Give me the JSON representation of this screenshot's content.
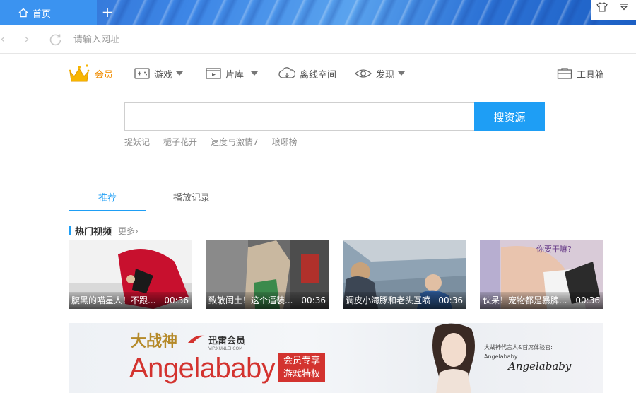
{
  "browser": {
    "tab": {
      "title": "首页",
      "icon": "home-icon"
    },
    "new_tab_icon": "plus-icon",
    "address": {
      "placeholder": "请输入网址",
      "value": ""
    }
  },
  "nav": {
    "vip": "会员",
    "games": "游戏",
    "library": "片库",
    "offline": "离线空间",
    "discover": "发现",
    "toolbox": "工具箱"
  },
  "search": {
    "button": "搜资源",
    "value": "",
    "hot_words": [
      "捉妖记",
      "栀子花开",
      "速度与激情7",
      "琅琊榜"
    ]
  },
  "content_tabs": [
    {
      "label": "推荐",
      "active": true
    },
    {
      "label": "播放记录",
      "active": false
    }
  ],
  "section": {
    "title": "热门视频",
    "more": "更多"
  },
  "videos": [
    {
      "title": "腹黑的喵星人！不跟...",
      "duration": "00:36"
    },
    {
      "title": "致敬闰土！这个逼装...",
      "duration": "00:36"
    },
    {
      "title": "调皮小海豚和老头互喷",
      "duration": "00:36"
    },
    {
      "title": "伙呆！宠物都是暴脾...",
      "duration": "00:36"
    }
  ],
  "banner": {
    "game_logo": "大战神",
    "xunlei": "迅雷会员",
    "xunlei_url": "VIP.XUNLEI.COM",
    "brand": "Angelababy",
    "badge_line1": "会员专享",
    "badge_line2": "游戏特权",
    "spokes_line1": "大战神代言人&首席体验官:",
    "spokes_line2": "Angelababy",
    "signature": "Angelababy"
  },
  "colors": {
    "accent": "#1e9ef5",
    "vip": "#f08c00",
    "brand_red": "#d3332f"
  }
}
